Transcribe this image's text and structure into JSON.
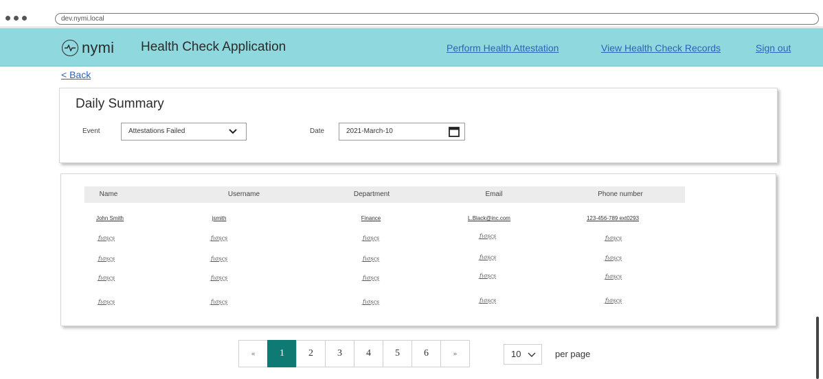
{
  "browser": {
    "url": "dev.nymi.local"
  },
  "header": {
    "logo_text": "nymi",
    "title": "Health Check Application",
    "nav": [
      "Perform Health Attestation",
      "View Health Check Records",
      "Sign out"
    ]
  },
  "back_label": "< Back",
  "summary": {
    "title": "Daily Summary",
    "event_label": "Event",
    "event_value": "Attestations Failed",
    "date_label": "Date",
    "date_value": "2021-March-10"
  },
  "table": {
    "columns": [
      "Name",
      "Username",
      "Department",
      "Email",
      "Phone number"
    ],
    "rows": [
      [
        "John Smith",
        "jsmith",
        "Finance",
        "L.Black@inc.com",
        "123-456-789 ext0293"
      ],
      [
        "ƒισșςș",
        "ƒισșςș",
        "ƒισșςș",
        "ƒισșςș",
        "ƒισșςș"
      ],
      [
        "ƒισșςș",
        "ƒισșςș",
        "ƒισșςș",
        "ƒισșςș",
        "ƒισșςș"
      ],
      [
        "ƒισșςș",
        "ƒισșςș",
        "ƒισșςș",
        "ƒισșςș",
        "ƒισșςș"
      ],
      [
        "ƒισșςș",
        "ƒισșςș",
        "ƒισșςș",
        "ƒισșςș",
        "ƒισșςș"
      ]
    ]
  },
  "pagination": {
    "first": "«",
    "pages": [
      "1",
      "2",
      "3",
      "4",
      "5",
      "6"
    ],
    "last": "»",
    "current_page": "1",
    "per_page_value": "10",
    "per_page_label": "per page"
  },
  "colors": {
    "header_bg": "#8fd8dd",
    "link": "#2e62b8",
    "active_page": "#0f7a74"
  },
  "icons": [
    "logo-pulse-icon",
    "chevron-down-icon",
    "calendar-icon"
  ]
}
